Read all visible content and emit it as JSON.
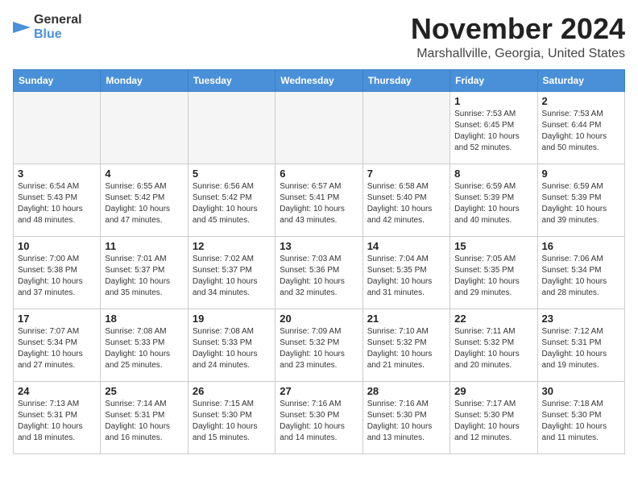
{
  "header": {
    "logo_general": "General",
    "logo_blue": "Blue",
    "month": "November 2024",
    "location": "Marshallville, Georgia, United States"
  },
  "calendar": {
    "headers": [
      "Sunday",
      "Monday",
      "Tuesday",
      "Wednesday",
      "Thursday",
      "Friday",
      "Saturday"
    ],
    "rows": [
      [
        {
          "day": "",
          "info": ""
        },
        {
          "day": "",
          "info": ""
        },
        {
          "day": "",
          "info": ""
        },
        {
          "day": "",
          "info": ""
        },
        {
          "day": "",
          "info": ""
        },
        {
          "day": "1",
          "info": "Sunrise: 7:53 AM\nSunset: 6:45 PM\nDaylight: 10 hours\nand 52 minutes."
        },
        {
          "day": "2",
          "info": "Sunrise: 7:53 AM\nSunset: 6:44 PM\nDaylight: 10 hours\nand 50 minutes."
        }
      ],
      [
        {
          "day": "3",
          "info": "Sunrise: 6:54 AM\nSunset: 5:43 PM\nDaylight: 10 hours\nand 48 minutes."
        },
        {
          "day": "4",
          "info": "Sunrise: 6:55 AM\nSunset: 5:42 PM\nDaylight: 10 hours\nand 47 minutes."
        },
        {
          "day": "5",
          "info": "Sunrise: 6:56 AM\nSunset: 5:42 PM\nDaylight: 10 hours\nand 45 minutes."
        },
        {
          "day": "6",
          "info": "Sunrise: 6:57 AM\nSunset: 5:41 PM\nDaylight: 10 hours\nand 43 minutes."
        },
        {
          "day": "7",
          "info": "Sunrise: 6:58 AM\nSunset: 5:40 PM\nDaylight: 10 hours\nand 42 minutes."
        },
        {
          "day": "8",
          "info": "Sunrise: 6:59 AM\nSunset: 5:39 PM\nDaylight: 10 hours\nand 40 minutes."
        },
        {
          "day": "9",
          "info": "Sunrise: 6:59 AM\nSunset: 5:39 PM\nDaylight: 10 hours\nand 39 minutes."
        }
      ],
      [
        {
          "day": "10",
          "info": "Sunrise: 7:00 AM\nSunset: 5:38 PM\nDaylight: 10 hours\nand 37 minutes."
        },
        {
          "day": "11",
          "info": "Sunrise: 7:01 AM\nSunset: 5:37 PM\nDaylight: 10 hours\nand 35 minutes."
        },
        {
          "day": "12",
          "info": "Sunrise: 7:02 AM\nSunset: 5:37 PM\nDaylight: 10 hours\nand 34 minutes."
        },
        {
          "day": "13",
          "info": "Sunrise: 7:03 AM\nSunset: 5:36 PM\nDaylight: 10 hours\nand 32 minutes."
        },
        {
          "day": "14",
          "info": "Sunrise: 7:04 AM\nSunset: 5:35 PM\nDaylight: 10 hours\nand 31 minutes."
        },
        {
          "day": "15",
          "info": "Sunrise: 7:05 AM\nSunset: 5:35 PM\nDaylight: 10 hours\nand 29 minutes."
        },
        {
          "day": "16",
          "info": "Sunrise: 7:06 AM\nSunset: 5:34 PM\nDaylight: 10 hours\nand 28 minutes."
        }
      ],
      [
        {
          "day": "17",
          "info": "Sunrise: 7:07 AM\nSunset: 5:34 PM\nDaylight: 10 hours\nand 27 minutes."
        },
        {
          "day": "18",
          "info": "Sunrise: 7:08 AM\nSunset: 5:33 PM\nDaylight: 10 hours\nand 25 minutes."
        },
        {
          "day": "19",
          "info": "Sunrise: 7:08 AM\nSunset: 5:33 PM\nDaylight: 10 hours\nand 24 minutes."
        },
        {
          "day": "20",
          "info": "Sunrise: 7:09 AM\nSunset: 5:32 PM\nDaylight: 10 hours\nand 23 minutes."
        },
        {
          "day": "21",
          "info": "Sunrise: 7:10 AM\nSunset: 5:32 PM\nDaylight: 10 hours\nand 21 minutes."
        },
        {
          "day": "22",
          "info": "Sunrise: 7:11 AM\nSunset: 5:32 PM\nDaylight: 10 hours\nand 20 minutes."
        },
        {
          "day": "23",
          "info": "Sunrise: 7:12 AM\nSunset: 5:31 PM\nDaylight: 10 hours\nand 19 minutes."
        }
      ],
      [
        {
          "day": "24",
          "info": "Sunrise: 7:13 AM\nSunset: 5:31 PM\nDaylight: 10 hours\nand 18 minutes."
        },
        {
          "day": "25",
          "info": "Sunrise: 7:14 AM\nSunset: 5:31 PM\nDaylight: 10 hours\nand 16 minutes."
        },
        {
          "day": "26",
          "info": "Sunrise: 7:15 AM\nSunset: 5:30 PM\nDaylight: 10 hours\nand 15 minutes."
        },
        {
          "day": "27",
          "info": "Sunrise: 7:16 AM\nSunset: 5:30 PM\nDaylight: 10 hours\nand 14 minutes."
        },
        {
          "day": "28",
          "info": "Sunrise: 7:16 AM\nSunset: 5:30 PM\nDaylight: 10 hours\nand 13 minutes."
        },
        {
          "day": "29",
          "info": "Sunrise: 7:17 AM\nSunset: 5:30 PM\nDaylight: 10 hours\nand 12 minutes."
        },
        {
          "day": "30",
          "info": "Sunrise: 7:18 AM\nSunset: 5:30 PM\nDaylight: 10 hours\nand 11 minutes."
        }
      ]
    ]
  }
}
